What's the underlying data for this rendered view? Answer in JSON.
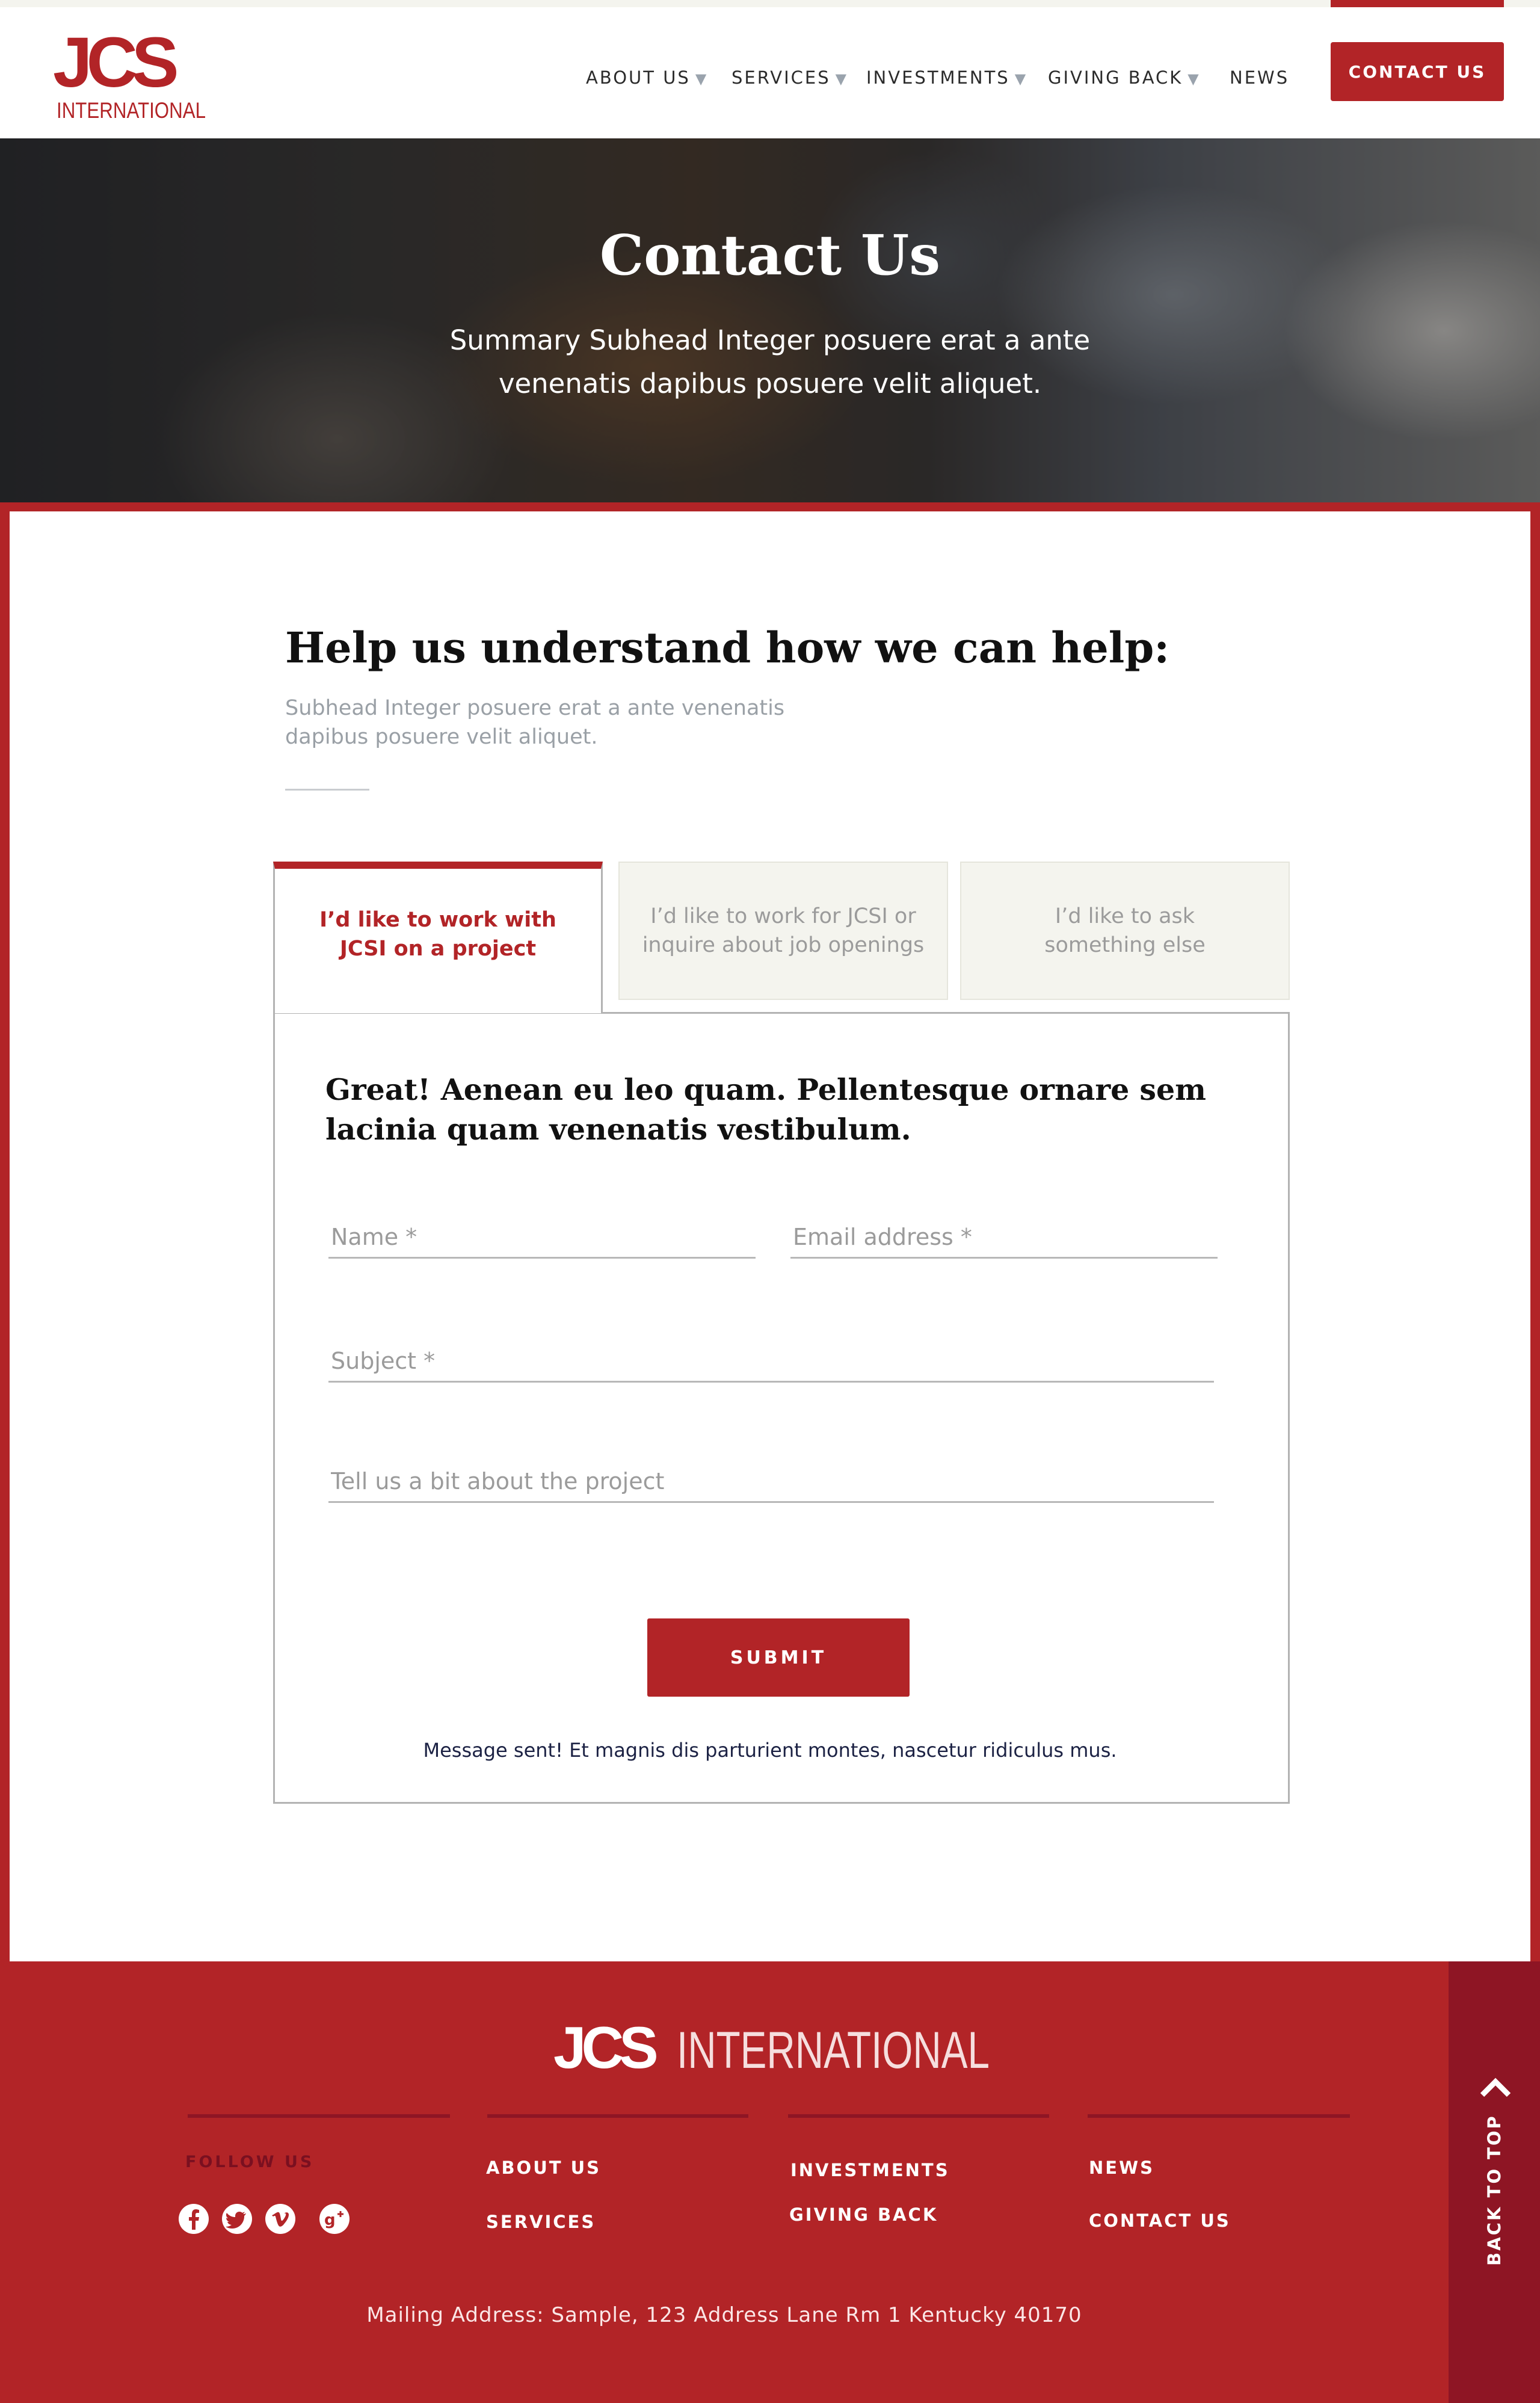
{
  "header": {
    "logo_text": "JCS",
    "logo_subtext": "INTERNATIONAL",
    "nav": [
      {
        "label": "ABOUT US",
        "caret": "▼"
      },
      {
        "label": "SERVICES",
        "caret": "▼"
      },
      {
        "label": "INVESTMENTS",
        "caret": "▼"
      },
      {
        "label": "GIVING BACK",
        "caret": "▼"
      },
      {
        "label": "NEWS",
        "caret": ""
      }
    ],
    "contact_button": "CONTACT US"
  },
  "hero": {
    "title": "Contact Us",
    "subtitle": "Summary Subhead Integer posuere erat a ante venenatis dapibus posuere velit aliquet."
  },
  "intro": {
    "title": "Help us understand how we can help:",
    "subtitle": "Subhead Integer posuere erat a ante venenatis dapibus posuere velit aliquet."
  },
  "tabs": [
    {
      "label": "I’d like to work with JCSI on a project",
      "active": true
    },
    {
      "label": "I’d like to work for JCSI or inquire about job openings",
      "active": false
    },
    {
      "label": "I’d like to ask something else",
      "active": false
    }
  ],
  "form": {
    "heading": "Great! Aenean eu leo quam. Pellentesque ornare sem lacinia quam venenatis vestibulum.",
    "name_placeholder": "Name *",
    "email_placeholder": "Email address *",
    "subject_placeholder": "Subject *",
    "message_placeholder": "Tell us a bit about the project",
    "submit_label": "SUBMIT",
    "success_message": "Message sent! Et magnis dis parturient montes, nascetur ridiculus mus."
  },
  "footer": {
    "logo_text": "JCS",
    "logo_subtext": "INTERNATIONAL",
    "follow_label": "FOLLOW US",
    "social_icons": [
      "facebook-icon",
      "twitter-icon",
      "vimeo-icon",
      "google-plus-icon"
    ],
    "links": {
      "about": "ABOUT US",
      "services": "SERVICES",
      "investments": "INVESTMENTS",
      "giving_back": "GIVING BACK",
      "news": "NEWS",
      "contact": "CONTACT US"
    },
    "mailing_address": "Mailing Address: Sample, 123 Address Lane Rm 1 Kentucky 40170",
    "back_to_top": "BACK TO TOP"
  },
  "colors": {
    "brand_red": "#b22427",
    "dark_red": "#8e1524",
    "tab_bg": "#f4f4ee",
    "muted_text": "#9b9b9b"
  }
}
